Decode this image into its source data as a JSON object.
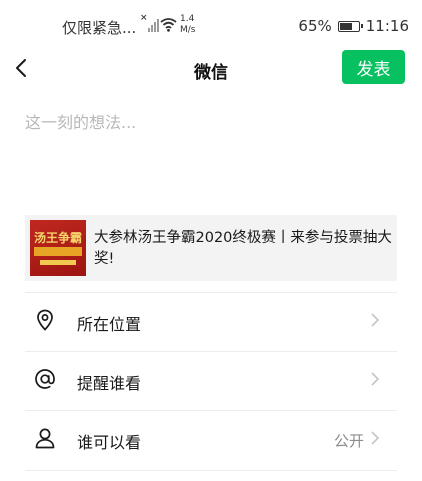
{
  "status_bar": {
    "carrier": "仅限紧急...",
    "speed_value": "1.4",
    "speed_unit": "M/s",
    "battery": "65%",
    "time": "11:16"
  },
  "nav": {
    "title": "微信",
    "post_label": "发表"
  },
  "composer": {
    "placeholder": "这一刻的想法..."
  },
  "link_card": {
    "title": "大参林汤王争霸2020终极赛丨来参与投票抽大奖!",
    "thumb_icon": "promo-thumbnail"
  },
  "options": [
    {
      "label": "所在位置",
      "icon": "location-pin-icon",
      "value": ""
    },
    {
      "label": "提醒谁看",
      "icon": "at-sign-icon",
      "value": ""
    },
    {
      "label": "谁可以看",
      "icon": "person-icon",
      "value": "公开"
    }
  ],
  "colors": {
    "accent": "#07c160",
    "divider": "#ececec",
    "card_bg": "#f3f3f3"
  }
}
